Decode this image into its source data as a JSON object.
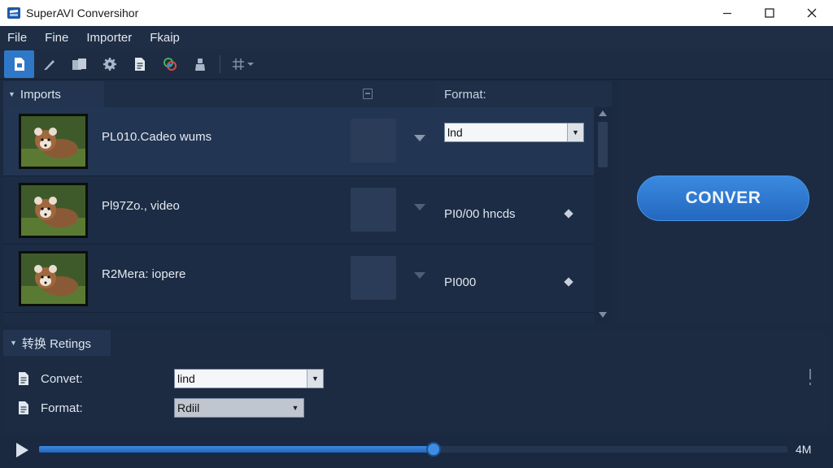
{
  "window": {
    "title": "SuperAVI Conversihor",
    "icons": {
      "app": "app-logo-icon",
      "minimize": "minimize-icon",
      "maximize": "maximize-icon",
      "close": "close-icon"
    }
  },
  "menu": [
    "File",
    "Fine",
    "Importer",
    "Fkaip"
  ],
  "toolbar": {
    "buttons": [
      "add-file-icon",
      "edit-icon",
      "files-icon",
      "gear-icon",
      "document-icon",
      "color-icon",
      "user-icon",
      "grid-icon"
    ],
    "active": "add-file-icon"
  },
  "imports": {
    "tab_label": "Imports",
    "format_header": "Format:",
    "rows": [
      {
        "name": "PL010.Cadeo wums",
        "format_select": "lnd"
      },
      {
        "name": "Pl97Zo., video",
        "format_text": "PI0/00 hncds"
      },
      {
        "name": "R2Mera: iopere",
        "format_text": "PI000"
      }
    ]
  },
  "convert": {
    "label": "CONVER"
  },
  "settings": {
    "tab_label": "转换 Retings",
    "rows": [
      {
        "label": "Convet:",
        "value": "lind"
      },
      {
        "label": "Format:",
        "value": "Rdiil"
      }
    ]
  },
  "playback": {
    "progress_fraction": 0.527,
    "time_label": "4M"
  },
  "colors": {
    "accent": "#2f78c8",
    "background": "#1b2a40",
    "panel": "#1c2b42"
  }
}
